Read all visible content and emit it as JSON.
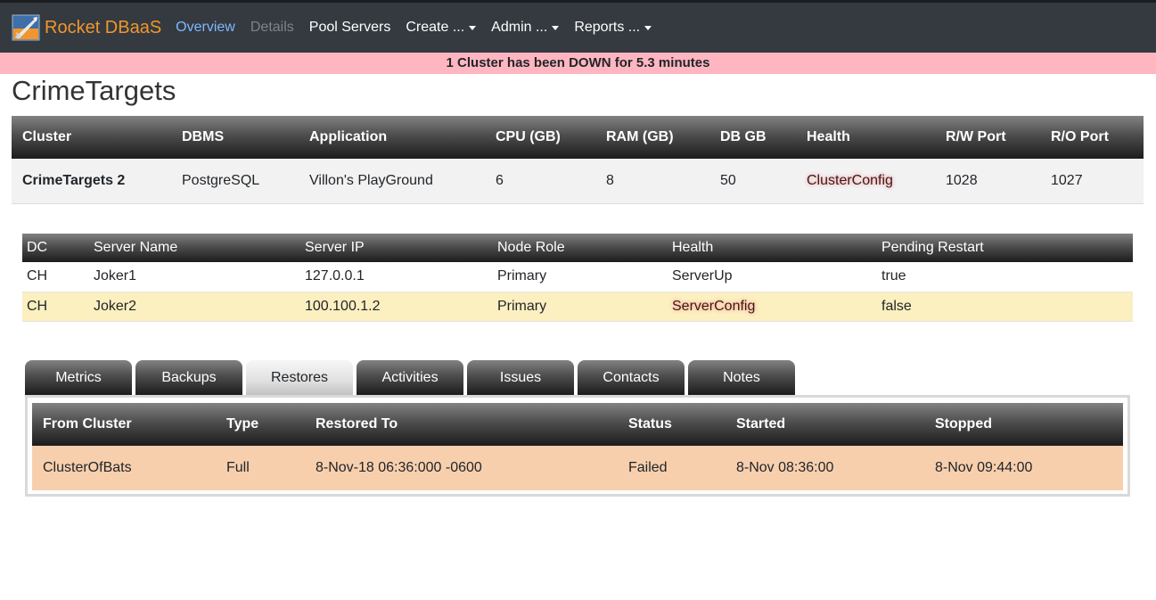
{
  "navbar": {
    "brand": "Rocket DBaaS",
    "items": [
      {
        "label": "Overview",
        "state": "active"
      },
      {
        "label": "Details",
        "state": "disabled"
      },
      {
        "label": "Pool Servers",
        "state": "normal"
      },
      {
        "label": "Create ...",
        "state": "dropdown"
      },
      {
        "label": "Admin ...",
        "state": "dropdown"
      },
      {
        "label": "Reports ...",
        "state": "dropdown"
      }
    ]
  },
  "alert": {
    "text": "1 Cluster has been DOWN for 5.3 minutes",
    "color": "#ffb6c1"
  },
  "page": {
    "title": "CrimeTargets"
  },
  "cluster_table": {
    "headers": [
      "Cluster",
      "DBMS",
      "Application",
      "CPU (GB)",
      "RAM (GB)",
      "DB GB",
      "Health",
      "R/W Port",
      "R/O Port"
    ],
    "rows": [
      {
        "cluster": "CrimeTargets 2",
        "dbms": "PostgreSQL",
        "application": "Villon's PlayGround",
        "cpu": "6",
        "ram": "8",
        "db_gb": "50",
        "health": "ClusterConfig",
        "rw_port": "1028",
        "ro_port": "1027"
      }
    ]
  },
  "server_table": {
    "headers": [
      "DC",
      "Server Name",
      "Server IP",
      "Node Role",
      "Health",
      "Pending Restart"
    ],
    "rows": [
      {
        "dc": "CH",
        "name": "Joker1",
        "ip": "127.0.0.1",
        "role": "Primary",
        "health": "ServerUp",
        "pending": "true"
      },
      {
        "dc": "CH",
        "name": "Joker2",
        "ip": "100.100.1.2",
        "role": "Primary",
        "health": "ServerConfig",
        "pending": "false"
      }
    ]
  },
  "tabs": {
    "items": [
      "Metrics",
      "Backups",
      "Restores",
      "Activities",
      "Issues",
      "Contacts",
      "Notes"
    ],
    "active": "Restores"
  },
  "restores_table": {
    "headers": [
      "From Cluster",
      "Type",
      "Restored To",
      "Status",
      "Started",
      "Stopped"
    ],
    "rows": [
      {
        "from": "ClusterOfBats",
        "type": "Full",
        "restored_to": "8-Nov-18 06:36:000 -0600",
        "status": "Failed",
        "started": "8-Nov 08:36:00",
        "stopped": "8-Nov 09:44:00"
      }
    ]
  },
  "colors": {
    "brand": "#f0962c",
    "nav_active": "#7fb8ff",
    "warn_row": "#fcefc0",
    "failed_row": "#f8cfad"
  },
  "icons": {
    "brand_logo": "rocket-logo-icon"
  }
}
